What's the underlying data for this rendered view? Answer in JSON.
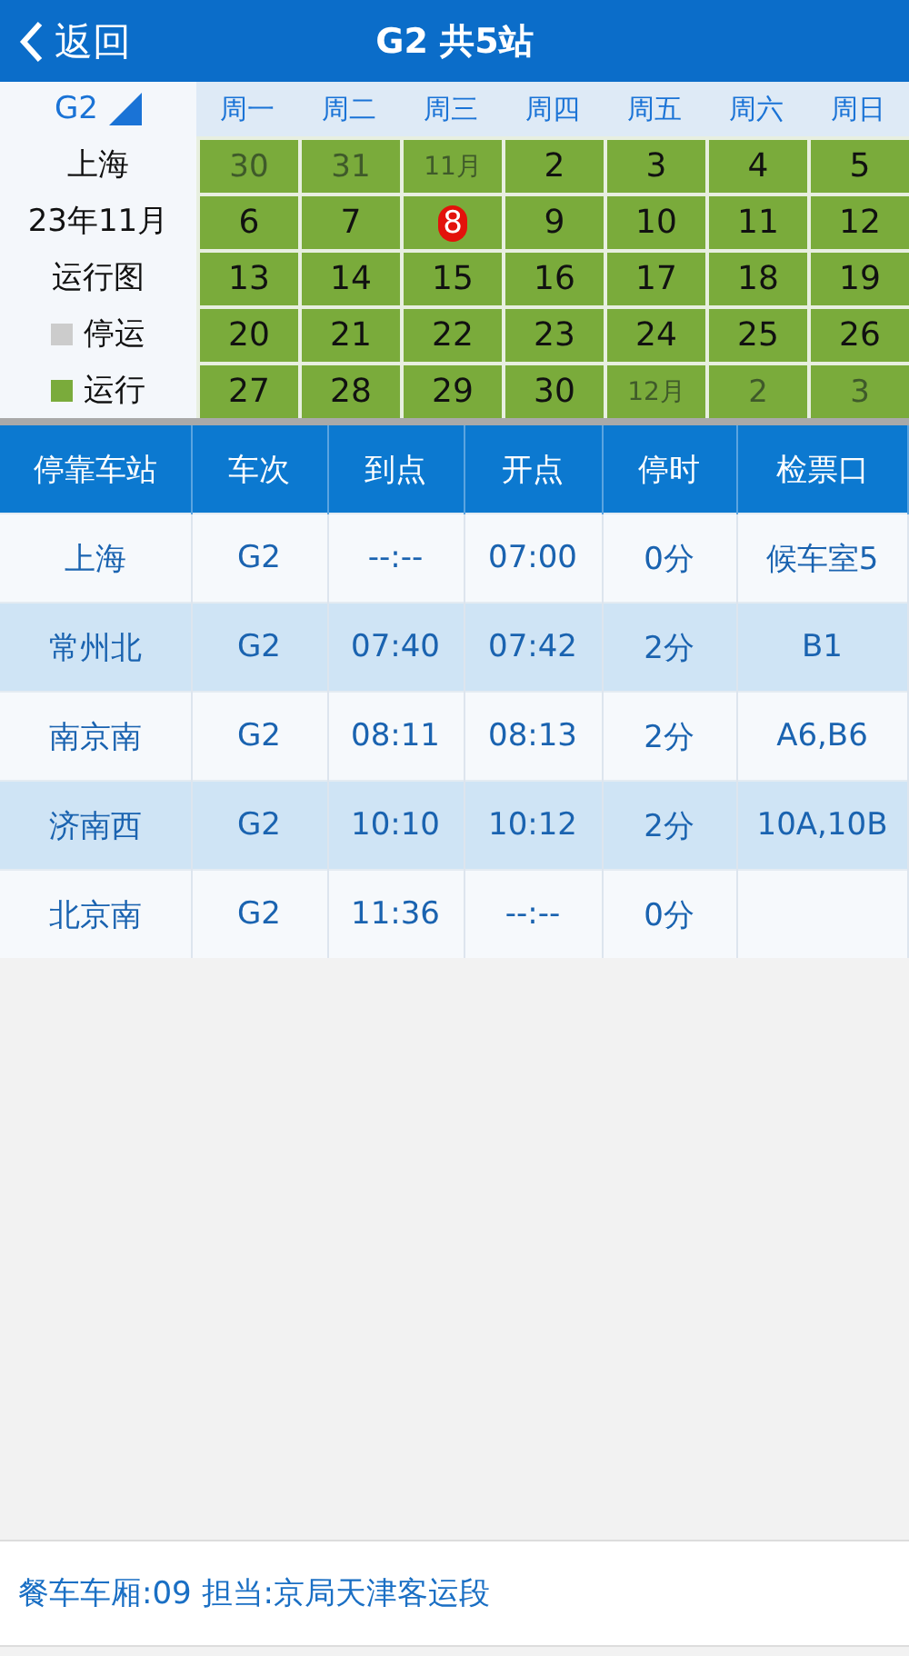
{
  "header": {
    "back": "返回",
    "title": "G2 共5站"
  },
  "calendar": {
    "train": "G2",
    "station": "上海",
    "month": "23年11月",
    "caption": "运行图",
    "legend": [
      {
        "label": "停运",
        "color": "#cccccc"
      },
      {
        "label": "运行",
        "color": "#7aab3b"
      }
    ],
    "weekdays": [
      "周一",
      "周二",
      "周三",
      "周四",
      "周五",
      "周六",
      "周日"
    ],
    "weeks": [
      [
        {
          "label": "30",
          "in_month": false,
          "running": true,
          "today": false
        },
        {
          "label": "31",
          "in_month": false,
          "running": true,
          "today": false
        },
        {
          "label": "11月",
          "in_month": false,
          "running": true,
          "today": false
        },
        {
          "label": "2",
          "in_month": true,
          "running": true,
          "today": false
        },
        {
          "label": "3",
          "in_month": true,
          "running": true,
          "today": false
        },
        {
          "label": "4",
          "in_month": true,
          "running": true,
          "today": false
        },
        {
          "label": "5",
          "in_month": true,
          "running": true,
          "today": false
        }
      ],
      [
        {
          "label": "6",
          "in_month": true,
          "running": true,
          "today": false
        },
        {
          "label": "7",
          "in_month": true,
          "running": true,
          "today": false
        },
        {
          "label": "8",
          "in_month": true,
          "running": true,
          "today": true
        },
        {
          "label": "9",
          "in_month": true,
          "running": true,
          "today": false
        },
        {
          "label": "10",
          "in_month": true,
          "running": true,
          "today": false
        },
        {
          "label": "11",
          "in_month": true,
          "running": true,
          "today": false
        },
        {
          "label": "12",
          "in_month": true,
          "running": true,
          "today": false
        }
      ],
      [
        {
          "label": "13",
          "in_month": true,
          "running": true,
          "today": false
        },
        {
          "label": "14",
          "in_month": true,
          "running": true,
          "today": false
        },
        {
          "label": "15",
          "in_month": true,
          "running": true,
          "today": false
        },
        {
          "label": "16",
          "in_month": true,
          "running": true,
          "today": false
        },
        {
          "label": "17",
          "in_month": true,
          "running": true,
          "today": false
        },
        {
          "label": "18",
          "in_month": true,
          "running": true,
          "today": false
        },
        {
          "label": "19",
          "in_month": true,
          "running": true,
          "today": false
        }
      ],
      [
        {
          "label": "20",
          "in_month": true,
          "running": true,
          "today": false
        },
        {
          "label": "21",
          "in_month": true,
          "running": true,
          "today": false
        },
        {
          "label": "22",
          "in_month": true,
          "running": true,
          "today": false
        },
        {
          "label": "23",
          "in_month": true,
          "running": true,
          "today": false
        },
        {
          "label": "24",
          "in_month": true,
          "running": true,
          "today": false
        },
        {
          "label": "25",
          "in_month": true,
          "running": true,
          "today": false
        },
        {
          "label": "26",
          "in_month": true,
          "running": true,
          "today": false
        }
      ],
      [
        {
          "label": "27",
          "in_month": true,
          "running": true,
          "today": false
        },
        {
          "label": "28",
          "in_month": true,
          "running": true,
          "today": false
        },
        {
          "label": "29",
          "in_month": true,
          "running": true,
          "today": false
        },
        {
          "label": "30",
          "in_month": true,
          "running": true,
          "today": false
        },
        {
          "label": "12月",
          "in_month": false,
          "running": true,
          "today": false
        },
        {
          "label": "2",
          "in_month": false,
          "running": true,
          "today": false
        },
        {
          "label": "3",
          "in_month": false,
          "running": true,
          "today": false
        }
      ]
    ]
  },
  "table": {
    "columns": [
      "停靠车站",
      "车次",
      "到点",
      "开点",
      "停时",
      "检票口"
    ],
    "rows": [
      [
        "上海",
        "G2",
        "--:--",
        "07:00",
        "0分",
        "候车室5"
      ],
      [
        "常州北",
        "G2",
        "07:40",
        "07:42",
        "2分",
        "B1"
      ],
      [
        "南京南",
        "G2",
        "08:11",
        "08:13",
        "2分",
        "A6,B6"
      ],
      [
        "济南西",
        "G2",
        "10:10",
        "10:12",
        "2分",
        "10A,10B"
      ],
      [
        "北京南",
        "G2",
        "11:36",
        "--:--",
        "0分",
        ""
      ]
    ]
  },
  "footer": "餐车车厢:09 担当:京局天津客运段"
}
